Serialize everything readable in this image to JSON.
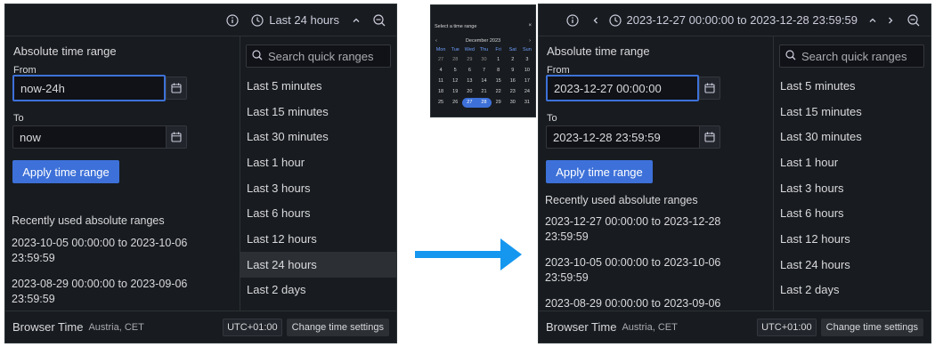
{
  "colors": {
    "panel_bg": "#181b1f",
    "accent": "#3d71d9",
    "arrow": "#1597f0",
    "text": "#d8d9dc"
  },
  "left_picker": {
    "topbar": {
      "range_label": "Last 24 hours",
      "icons": [
        "info-icon",
        "clock-icon",
        "chevron-up-icon",
        "zoom-out-icon"
      ]
    },
    "absolute_title": "Absolute time range",
    "from_label": "From",
    "from_value": "now-24h",
    "to_label": "To",
    "to_value": "now",
    "apply_label": "Apply time range",
    "recent_title": "Recently used absolute ranges",
    "recent_items": [
      "2023-10-05 00:00:00 to 2023-10-06 23:59:59",
      "2023-08-29 00:00:00 to 2023-09-06 23:59:59"
    ],
    "search_placeholder": "Search quick ranges",
    "quick_ranges": [
      "Last 5 minutes",
      "Last 15 minutes",
      "Last 30 minutes",
      "Last 1 hour",
      "Last 3 hours",
      "Last 6 hours",
      "Last 12 hours",
      "Last 24 hours",
      "Last 2 days"
    ],
    "quick_active": "Last 24 hours",
    "footer": {
      "browser_time": "Browser Time",
      "timezone": "Austria, CET",
      "utc": "UTC+01:00",
      "change": "Change time settings"
    }
  },
  "calendar": {
    "title": "Select a time range",
    "close": "×",
    "month": "December 2023",
    "prev": "‹",
    "next": "›",
    "weekdays": [
      "Mon",
      "Tue",
      "Wed",
      "Thu",
      "Fri",
      "Sat",
      "Sun"
    ],
    "weeks": [
      [
        "27",
        "28",
        "29",
        "30",
        "1",
        "2",
        "3"
      ],
      [
        "4",
        "5",
        "6",
        "7",
        "8",
        "9",
        "10"
      ],
      [
        "11",
        "12",
        "13",
        "14",
        "15",
        "16",
        "17"
      ],
      [
        "18",
        "19",
        "20",
        "21",
        "22",
        "23",
        "24"
      ],
      [
        "25",
        "26",
        "27",
        "28",
        "29",
        "30",
        "31"
      ]
    ],
    "selected_start": "27",
    "selected_end": "28"
  },
  "right_picker": {
    "topbar": {
      "range_label": "2023-12-27 00:00:00 to 2023-12-28 23:59:59",
      "icons": [
        "info-icon",
        "chevron-left-icon",
        "clock-icon",
        "chevron-up-icon",
        "chevron-right-icon",
        "zoom-out-icon"
      ]
    },
    "absolute_title": "Absolute time range",
    "from_label": "From",
    "from_value": "2023-12-27 00:00:00",
    "to_label": "To",
    "to_value": "2023-12-28 23:59:59",
    "apply_label": "Apply time range",
    "recent_title": "Recently used absolute ranges",
    "recent_items": [
      "2023-12-27 00:00:00 to 2023-12-28 23:59:59",
      "2023-10-05 00:00:00 to 2023-10-06 23:59:59",
      "2023-08-29 00:00:00 to 2023-09-06"
    ],
    "search_placeholder": "Search quick ranges",
    "quick_ranges": [
      "Last 5 minutes",
      "Last 15 minutes",
      "Last 30 minutes",
      "Last 1 hour",
      "Last 3 hours",
      "Last 6 hours",
      "Last 12 hours",
      "Last 24 hours",
      "Last 2 days"
    ],
    "footer": {
      "browser_time": "Browser Time",
      "timezone": "Austria, CET",
      "utc": "UTC+01:00",
      "change": "Change time settings"
    }
  }
}
